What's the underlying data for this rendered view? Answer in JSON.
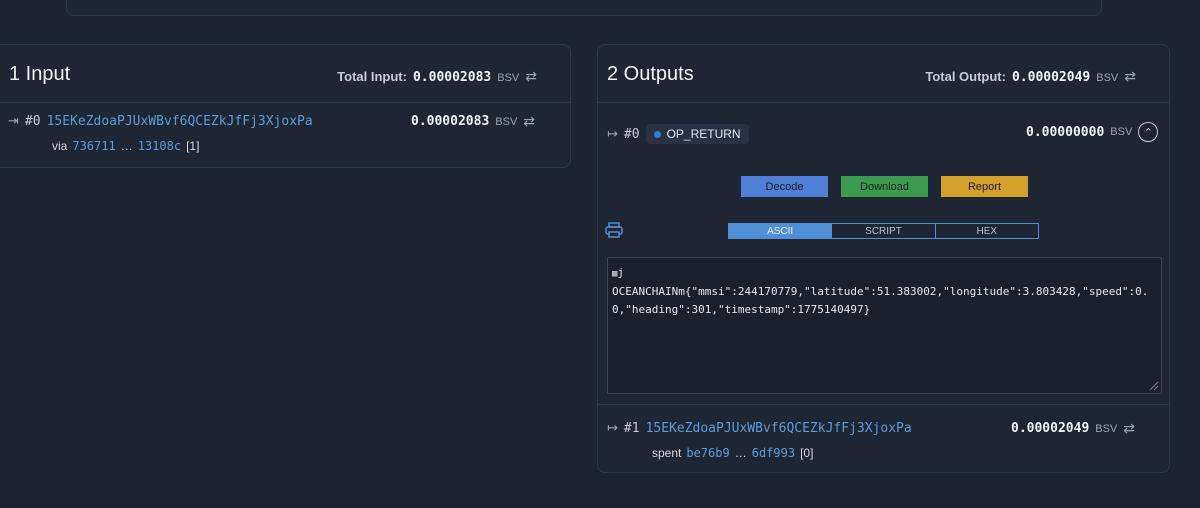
{
  "inputs": {
    "title": "1 Input",
    "total_label": "Total Input:",
    "total_value": "0.00002083",
    "unit": "BSV",
    "items": [
      {
        "index": "#0",
        "address": "15EKeZdoaPJUxWBvf6QCEZkJfFj3XjoxPa",
        "amount": "0.00002083",
        "unit": "BSV",
        "via_label": "via",
        "tx_start": "736711",
        "ellipsis": "…",
        "tx_end": "13108c",
        "vout": "[1]"
      }
    ]
  },
  "outputs": {
    "title": "2 Outputs",
    "total_label": "Total Output:",
    "total_value": "0.00002049",
    "unit": "BSV",
    "items": [
      {
        "index": "#0",
        "type_label": "OP_RETURN",
        "amount": "0.00000000",
        "unit": "BSV",
        "buttons": {
          "decode": "Decode",
          "download": "Download",
          "report": "Report"
        },
        "tabs": [
          "ASCII",
          "SCRIPT",
          "HEX"
        ],
        "active_tab": "ASCII",
        "content_line1": "j",
        "content_line2": "OCEANCHAINm{\"mmsi\":244170779,\"latitude\":51.383002,\"longitude\":3.803428,\"speed\":0.",
        "content_line3": "0,\"heading\":301,\"timestamp\":1775140497}"
      },
      {
        "index": "#1",
        "address": "15EKeZdoaPJUxWBvf6QCEZkJfFj3XjoxPa",
        "amount": "0.00002049",
        "unit": "BSV",
        "spent_label": "spent",
        "tx_start": "be76b9",
        "ellipsis": "…",
        "tx_end": "6df993",
        "vout": "[0]"
      }
    ]
  },
  "colors": {
    "background": "#1c2431",
    "card": "#1e2633",
    "link": "#5b9bdc",
    "decode": "#4f7fd6",
    "download": "#3c9a4e",
    "report": "#d3a12b"
  },
  "icons": {
    "swap": "swap-arrows-icon",
    "input": "sign-in-icon",
    "output": "sign-out-icon",
    "print": "printer-icon",
    "collapse": "chevron-up-icon"
  }
}
